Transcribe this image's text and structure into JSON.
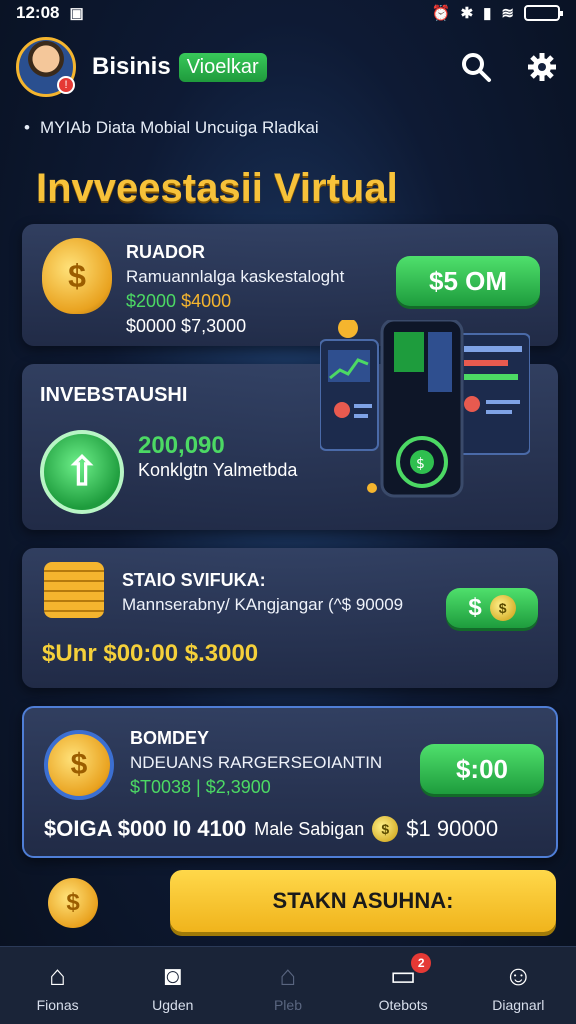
{
  "status_bar": {
    "time": "12:08",
    "left_icon": "image-icon",
    "right_icons": [
      "alarm-icon",
      "bluetooth-icon",
      "signal-icon",
      "wifi-icon",
      "battery-icon"
    ]
  },
  "header": {
    "app_name": "Bisinis",
    "app_tag": "Vioelkar"
  },
  "subtitle": "MYIAb Diata Mobial Uncuiga Rladkai",
  "section_title": "Invveestasii Virtual",
  "card1": {
    "head": "RUADOR",
    "sub": "Ramuannlalga kaskestaloght",
    "line1_green": "$2000",
    "line1_gold": "$4000",
    "line2": "$0000 $7,3000",
    "button": "$5 OM"
  },
  "card2": {
    "title": "INVEBSTAUSHI",
    "value": "200,090",
    "desc": "Konklgtn Yalmetbda"
  },
  "card3": {
    "head": "STAIO SVIFUKA:",
    "sub": "Mannserabny/ KAngjangar (^$ 90009",
    "button": "$",
    "bottom": "$Unr $00:00 $.3000"
  },
  "card4": {
    "head": "BOMDEY",
    "sub": "NDEUANS RARGERSEOIANTIN",
    "line": "$T0038 | $2,3900",
    "button": "$:00",
    "bottom_left": "$OIGA $000 I0 4100",
    "bottom_mid": "Male Sabigan",
    "bottom_right": "$1 90000"
  },
  "cta": "STAKN ASUHNA:",
  "nav": [
    {
      "label": "Fionas",
      "icon": "home-icon"
    },
    {
      "label": "Ugden",
      "icon": "camera-icon"
    },
    {
      "label": "Pleb",
      "icon": "bag-icon"
    },
    {
      "label": "Otebots",
      "icon": "chat-icon",
      "badge": "2"
    },
    {
      "label": "Diagnarl",
      "icon": "user-icon"
    }
  ],
  "colors": {
    "accent_green": "#4cd964",
    "accent_gold": "#f5b52e",
    "cta_yellow": "#ffd84a"
  }
}
